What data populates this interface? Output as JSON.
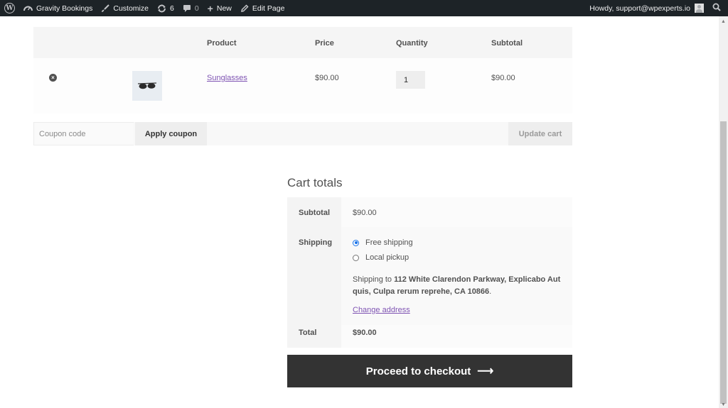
{
  "admin_bar": {
    "site_name": "Gravity Bookings",
    "customize": "Customize",
    "updates_count": "6",
    "comments_count": "0",
    "new_label": "New",
    "edit_page_label": "Edit Page",
    "howdy": "Howdy, support@wpexperts.io"
  },
  "cart": {
    "headers": {
      "product": "Product",
      "price": "Price",
      "quantity": "Quantity",
      "subtotal": "Subtotal"
    },
    "items": [
      {
        "remove_icon": "remove-circle-x",
        "name": "Sunglasses",
        "price": "$90.00",
        "quantity": "1",
        "subtotal": "$90.00"
      }
    ],
    "coupon_placeholder": "Coupon code",
    "apply_coupon_label": "Apply coupon",
    "update_cart_label": "Update cart"
  },
  "totals": {
    "title": "Cart totals",
    "subtotal_label": "Subtotal",
    "subtotal_value": "$90.00",
    "shipping_label": "Shipping",
    "shipping_options": [
      {
        "label": "Free shipping",
        "selected": true
      },
      {
        "label": "Local pickup",
        "selected": false
      }
    ],
    "shipping_to_prefix": "Shipping to",
    "shipping_address": "112 White Clarendon Parkway, Explicabo Aut quis, Culpa rerum reprehe, CA 10866",
    "shipping_to_suffix": ".",
    "change_address": "Change address",
    "total_label": "Total",
    "total_value": "$90.00"
  },
  "checkout": {
    "label": "Proceed to checkout",
    "arrow": "⟶"
  },
  "colors": {
    "admin_bar_bg": "#1d2327",
    "link_purple": "#7f54b3",
    "checkout_bg": "#333333"
  }
}
